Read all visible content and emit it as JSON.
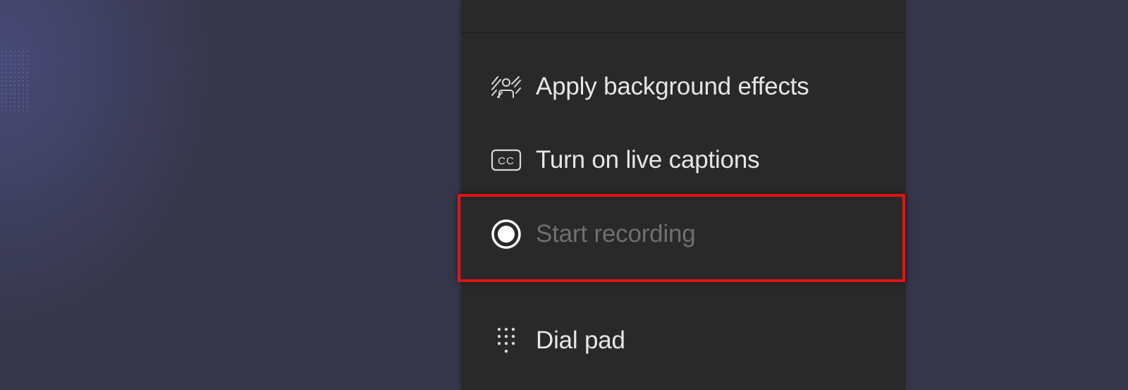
{
  "menu": {
    "items": [
      {
        "label": "Apply background effects",
        "icon": "background-effects-icon",
        "enabled": true
      },
      {
        "label": "Turn on live captions",
        "icon": "closed-captions-icon",
        "enabled": true
      },
      {
        "label": "Start recording",
        "icon": "record-icon",
        "enabled": false
      },
      {
        "label": "Dial pad",
        "icon": "dial-pad-icon",
        "enabled": true
      }
    ]
  },
  "colors": {
    "background": "#363649",
    "menu_background": "#292929",
    "menu_text": "#e6e6e6",
    "disabled_text": "#6f6f6f",
    "highlight_border": "#e01414"
  }
}
